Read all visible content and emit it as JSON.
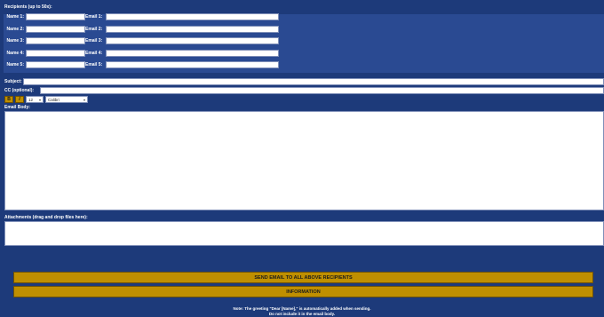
{
  "recipients": {
    "header": "Recipients (up to 50x):",
    "rows": [
      {
        "name_label": "Name 1:",
        "email_label": "Email 1:",
        "name_value": "",
        "email_value": ""
      },
      {
        "name_label": "Name 2:",
        "email_label": "Email 2:",
        "name_value": "",
        "email_value": ""
      },
      {
        "name_label": "Name 3:",
        "email_label": "Email 3:",
        "name_value": "",
        "email_value": ""
      },
      {
        "name_label": "Name 4:",
        "email_label": "Email 4:",
        "name_value": "",
        "email_value": ""
      },
      {
        "name_label": "Name 5:",
        "email_label": "Email 5:",
        "name_value": "",
        "email_value": ""
      }
    ]
  },
  "subject": {
    "label": "Subject:",
    "value": ""
  },
  "cc": {
    "label": "CC (optional):",
    "value": ""
  },
  "toolbar": {
    "bold_label": "B",
    "italic_label": "I",
    "font_size": "12",
    "font_name": "Calibri"
  },
  "body": {
    "label": "Email Body:",
    "value": ""
  },
  "attachments": {
    "label": "Attachments (drag and drop files here):"
  },
  "buttons": {
    "send_label": "SEND EMAIL TO ALL ABOVE RECIPIENTS",
    "info_label": "INFORMATION"
  },
  "note": {
    "line1": "Note: The greeting \"Dear [Name],\" is automatically added when sending.",
    "line2": "Do not include it in the email body."
  },
  "colors": {
    "background": "#1d3a7a",
    "panel": "#2a4a92",
    "button": "#bf8f00"
  }
}
